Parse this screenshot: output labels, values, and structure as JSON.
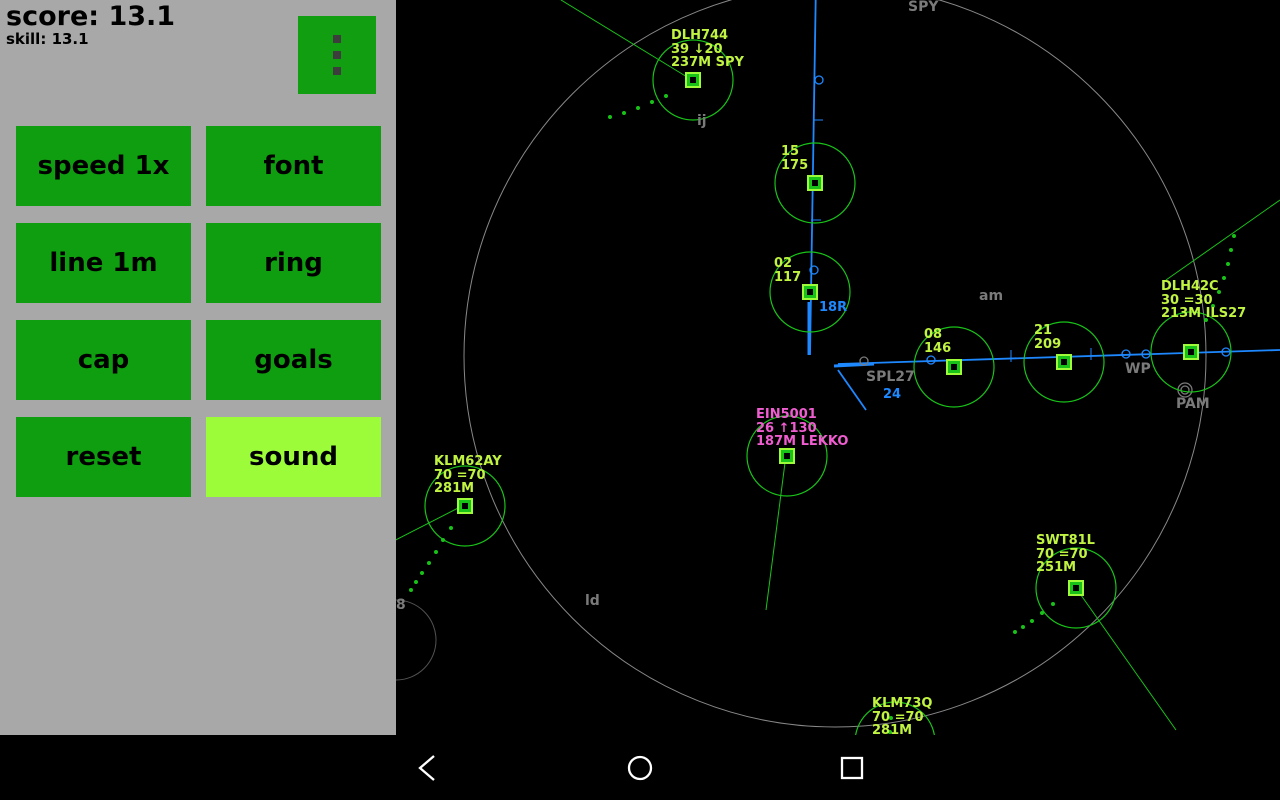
{
  "status": {
    "score_label": "score: ",
    "score_value": "13.1",
    "skill_label": "skill: ",
    "skill_value": "13.1"
  },
  "buttons": {
    "speed": "speed 1x",
    "font": "font",
    "line": "line 1m",
    "ring": "ring",
    "cap": "cap",
    "goals": "goals",
    "reset": "reset",
    "sound": "sound"
  },
  "runway": {
    "name": "18R",
    "spl": "SPL27",
    "spl_num": "24"
  },
  "waypoints": {
    "spy": "SPY",
    "ij": "ij",
    "am": "am",
    "wp": "WP",
    "pam": "PAM",
    "ld": "ld",
    "b": "8"
  },
  "aircraft": {
    "dlh744": {
      "cs": "DLH744",
      "l2": "39 ↓20",
      "l3": "237M SPY"
    },
    "ac15": {
      "cs": "15",
      "l2": "175",
      "l3": ""
    },
    "ac02": {
      "cs": "02",
      "l2": "117",
      "l3": ""
    },
    "ac08": {
      "cs": "08",
      "l2": "146",
      "l3": ""
    },
    "ac21": {
      "cs": "21",
      "l2": "209",
      "l3": ""
    },
    "dlh42c": {
      "cs": "DLH42C",
      "l2": "30 =30",
      "l3": "213M ILS27"
    },
    "klm62ay": {
      "cs": "KLM62AY",
      "l2": "70 =70",
      "l3": "281M"
    },
    "ein5001": {
      "cs": "EIN5001",
      "l2": "26 ↑130",
      "l3": "187M LEKKO"
    },
    "swt81l": {
      "cs": "SWT81L",
      "l2": "70 =70",
      "l3": "251M"
    },
    "klm73q": {
      "cs": "KLM73Q",
      "l2": "70 =70",
      "l3": "281M"
    }
  }
}
